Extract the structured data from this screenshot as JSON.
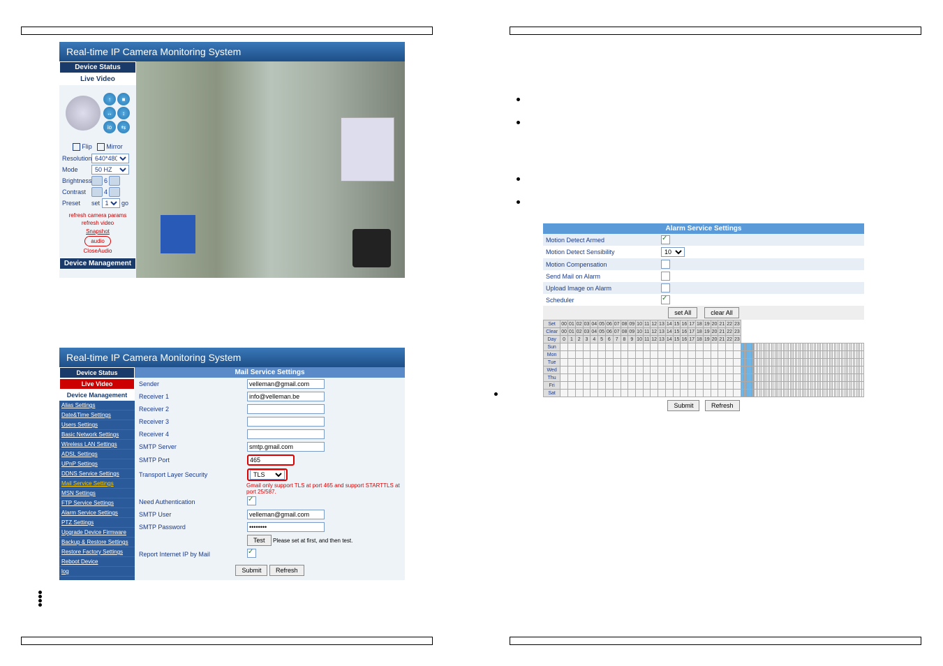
{
  "app_title": "Real-time IP Camera Monitoring System",
  "left_panel": {
    "tabs": {
      "device_status": "Device Status",
      "live_video": "Live Video",
      "device_mgmt": "Device Management"
    },
    "flip": "Flip",
    "mirror": "Mirror",
    "resolution_lbl": "Resolution",
    "resolution": "640*480",
    "mode_lbl": "Mode",
    "mode": "50 HZ",
    "brightness_lbl": "Brightness",
    "brightness": "6",
    "contrast_lbl": "Contrast",
    "contrast": "4",
    "preset_lbl": "Preset",
    "preset_set": "set",
    "preset_val": "1",
    "preset_go": "go",
    "links": {
      "refresh_params": "refresh camera params",
      "refresh_video": "refresh video",
      "snapshot": "Snapshot",
      "audio": "audio",
      "close_audio": "CloseAudio"
    }
  },
  "mail": {
    "header": "Mail Service Settings",
    "nav_tabs": {
      "device_status": "Device Status",
      "live_video": "Live Video",
      "device_mgmt": "Device Management"
    },
    "nav": [
      "Alias Settings",
      "Date&Time Settings",
      "Users Settings",
      "Basic Network Settings",
      "Wireless LAN Settings",
      "ADSL Settings",
      "UPnP Settings",
      "DDNS Service Settings",
      "Mail Service Settings",
      "MSN Settings",
      "FTP Service Settings",
      "Alarm Service Settings",
      "PTZ Settings",
      "Upgrade Device Firmware",
      "Backup & Restore Settings",
      "Restore Factory Settings",
      "Reboot Device",
      "log"
    ],
    "rows": {
      "sender_lbl": "Sender",
      "sender": "velleman@gmail.com",
      "r1_lbl": "Receiver 1",
      "r1": "info@velleman.be",
      "r2_lbl": "Receiver 2",
      "r2": "",
      "r3_lbl": "Receiver 3",
      "r3": "",
      "r4_lbl": "Receiver 4",
      "r4": "",
      "smtp_lbl": "SMTP Server",
      "smtp": "smtp.gmail.com",
      "port_lbl": "SMTP Port",
      "port": "465",
      "tls_lbl": "Transport Layer Security",
      "tls": "TLS",
      "tls_note": "Gmail only support TLS at port 465 and support STARTTLS at port 25/587.",
      "auth_lbl": "Need Authentication",
      "user_lbl": "SMTP User",
      "user": "velleman@gmail.com",
      "pw_lbl": "SMTP Password",
      "pw": "••••••••",
      "test_btn": "Test",
      "test_note": "Please set at first, and then test.",
      "report_lbl": "Report Internet IP by Mail"
    },
    "submit": "Submit",
    "refresh": "Refresh"
  },
  "alarm": {
    "header": "Alarm Service Settings",
    "motion_armed": "Motion Detect Armed",
    "sensibility": "Motion Detect Sensibility",
    "sensibility_val": "10",
    "compensation": "Motion Compensation",
    "send_mail": "Send Mail on Alarm",
    "upload": "Upload Image on Alarm",
    "scheduler": "Scheduler",
    "set_all": "set All",
    "clear_all": "clear All",
    "set": "Set",
    "clear": "Clear",
    "day": "Day",
    "days": [
      "Sun",
      "Mon",
      "Tue",
      "Wed",
      "Thu",
      "Fri",
      "Sat"
    ],
    "hours": [
      "00",
      "01",
      "02",
      "03",
      "04",
      "05",
      "06",
      "07",
      "08",
      "09",
      "10",
      "11",
      "12",
      "13",
      "14",
      "15",
      "16",
      "17",
      "18",
      "19",
      "20",
      "21",
      "22",
      "23"
    ],
    "nums": [
      "0",
      "1",
      "2",
      "3",
      "4",
      "5",
      "6",
      "7",
      "8",
      "9",
      "10",
      "11",
      "12",
      "13",
      "14",
      "15",
      "16",
      "17",
      "18",
      "19",
      "20",
      "21",
      "22",
      "23"
    ],
    "submit": "Submit",
    "refresh": "Refresh"
  }
}
